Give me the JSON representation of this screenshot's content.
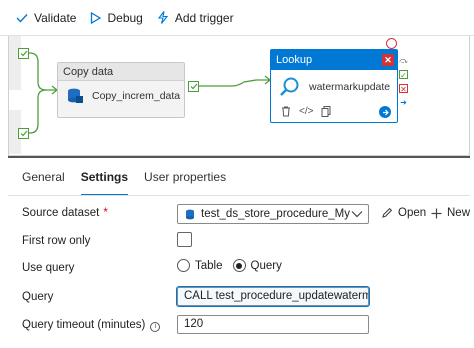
{
  "toolbar": {
    "validate": "Validate",
    "debug": "Debug",
    "add_trigger": "Add trigger"
  },
  "canvas": {
    "copy_node": {
      "header": "Copy data",
      "name": "Copy_increm_data",
      "icon": "database-icon"
    },
    "lookup_node": {
      "header": "Lookup",
      "name": "watermarkupdate",
      "icon": "lookup-search-icon"
    }
  },
  "tabs": [
    "General",
    "Settings",
    "User properties"
  ],
  "active_tab": "Settings",
  "form": {
    "source_dataset_label": "Source dataset",
    "required_marker": "*",
    "source_dataset_value": "test_ds_store_procedure_MySql",
    "open_label": "Open",
    "new_label": "New",
    "first_row_only_label": "First row only",
    "first_row_only_checked": false,
    "use_query_label": "Use query",
    "use_query_options": [
      "Table",
      "Query"
    ],
    "use_query_selected": "Query",
    "query_label": "Query",
    "query_value": "CALL test_procedure_updatewaterma...",
    "query_timeout_label": "Query timeout (minutes)",
    "query_timeout_value": "120"
  },
  "colors": {
    "accent": "#0078d4",
    "success": "#4d9e3a",
    "error": "#d13438"
  }
}
